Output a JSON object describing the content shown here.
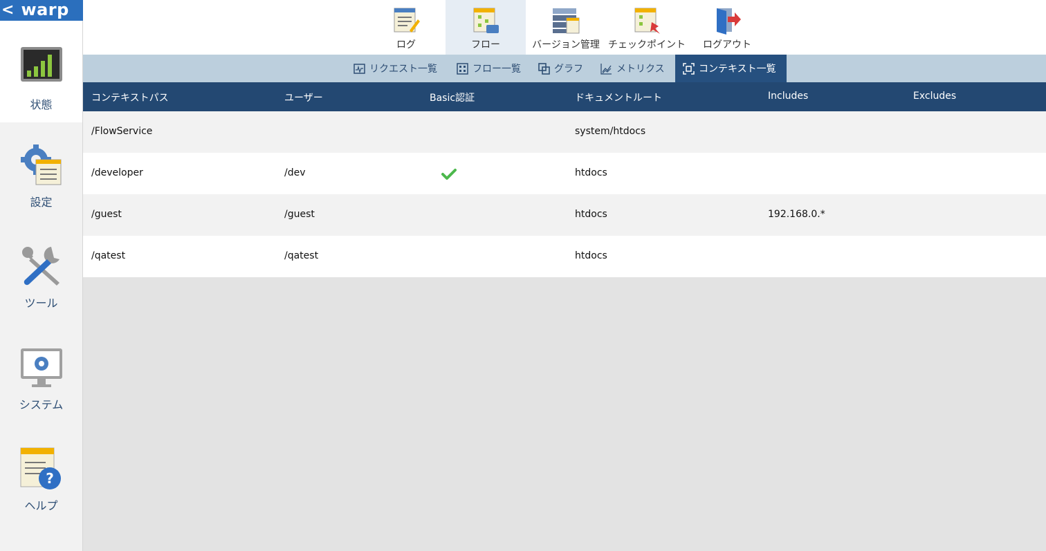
{
  "app": {
    "logo_text": "warp",
    "logo_chevron": "<"
  },
  "sidebar": {
    "items": [
      {
        "label": "状態",
        "icon": "bar-chart-icon",
        "active": true
      },
      {
        "label": "設定",
        "icon": "gear-settings-icon"
      },
      {
        "label": "ツール",
        "icon": "tools-icon"
      },
      {
        "label": "システム",
        "icon": "monitor-gear-icon"
      },
      {
        "label": "ヘルプ",
        "icon": "help-document-icon"
      }
    ]
  },
  "topnav": {
    "items": [
      {
        "label": "ログ",
        "icon": "notepad-pencil-icon"
      },
      {
        "label": "フロー",
        "icon": "flow-document-icon",
        "active": true
      },
      {
        "label": "バージョン管理",
        "icon": "server-stack-icon"
      },
      {
        "label": "チェックポイント",
        "icon": "checkpoint-pin-icon"
      },
      {
        "label": "ログアウト",
        "icon": "logout-door-icon"
      }
    ]
  },
  "subtabs": {
    "items": [
      {
        "label": "リクエスト一覧",
        "icon": "request-list-icon"
      },
      {
        "label": "フロー一覧",
        "icon": "flow-list-icon"
      },
      {
        "label": "グラフ",
        "icon": "graph-icon"
      },
      {
        "label": "メトリクス",
        "icon": "metrics-icon"
      },
      {
        "label": "コンテキスト一覧",
        "icon": "context-list-icon",
        "active": true
      }
    ]
  },
  "table": {
    "headers": [
      "コンテキストパス",
      "ユーザー",
      "Basic認証",
      "ドキュメントルート",
      "Includes",
      "Excludes"
    ],
    "rows": [
      {
        "path": "/FlowService",
        "user": "",
        "basic_auth": false,
        "docroot": "system/htdocs",
        "includes": "",
        "excludes": ""
      },
      {
        "path": "/developer",
        "user": "/dev",
        "basic_auth": true,
        "docroot": "htdocs",
        "includes": "",
        "excludes": ""
      },
      {
        "path": "/guest",
        "user": "/guest",
        "basic_auth": false,
        "docroot": "htdocs",
        "includes": "192.168.0.*",
        "excludes": ""
      },
      {
        "path": "/qatest",
        "user": "/qatest",
        "basic_auth": false,
        "docroot": "htdocs",
        "includes": "",
        "excludes": ""
      }
    ]
  },
  "colors": {
    "accent_dark": "#234872",
    "active_subtab": "#26507f",
    "subtab_bar": "#bccfdd",
    "check_green": "#4cb84c"
  }
}
